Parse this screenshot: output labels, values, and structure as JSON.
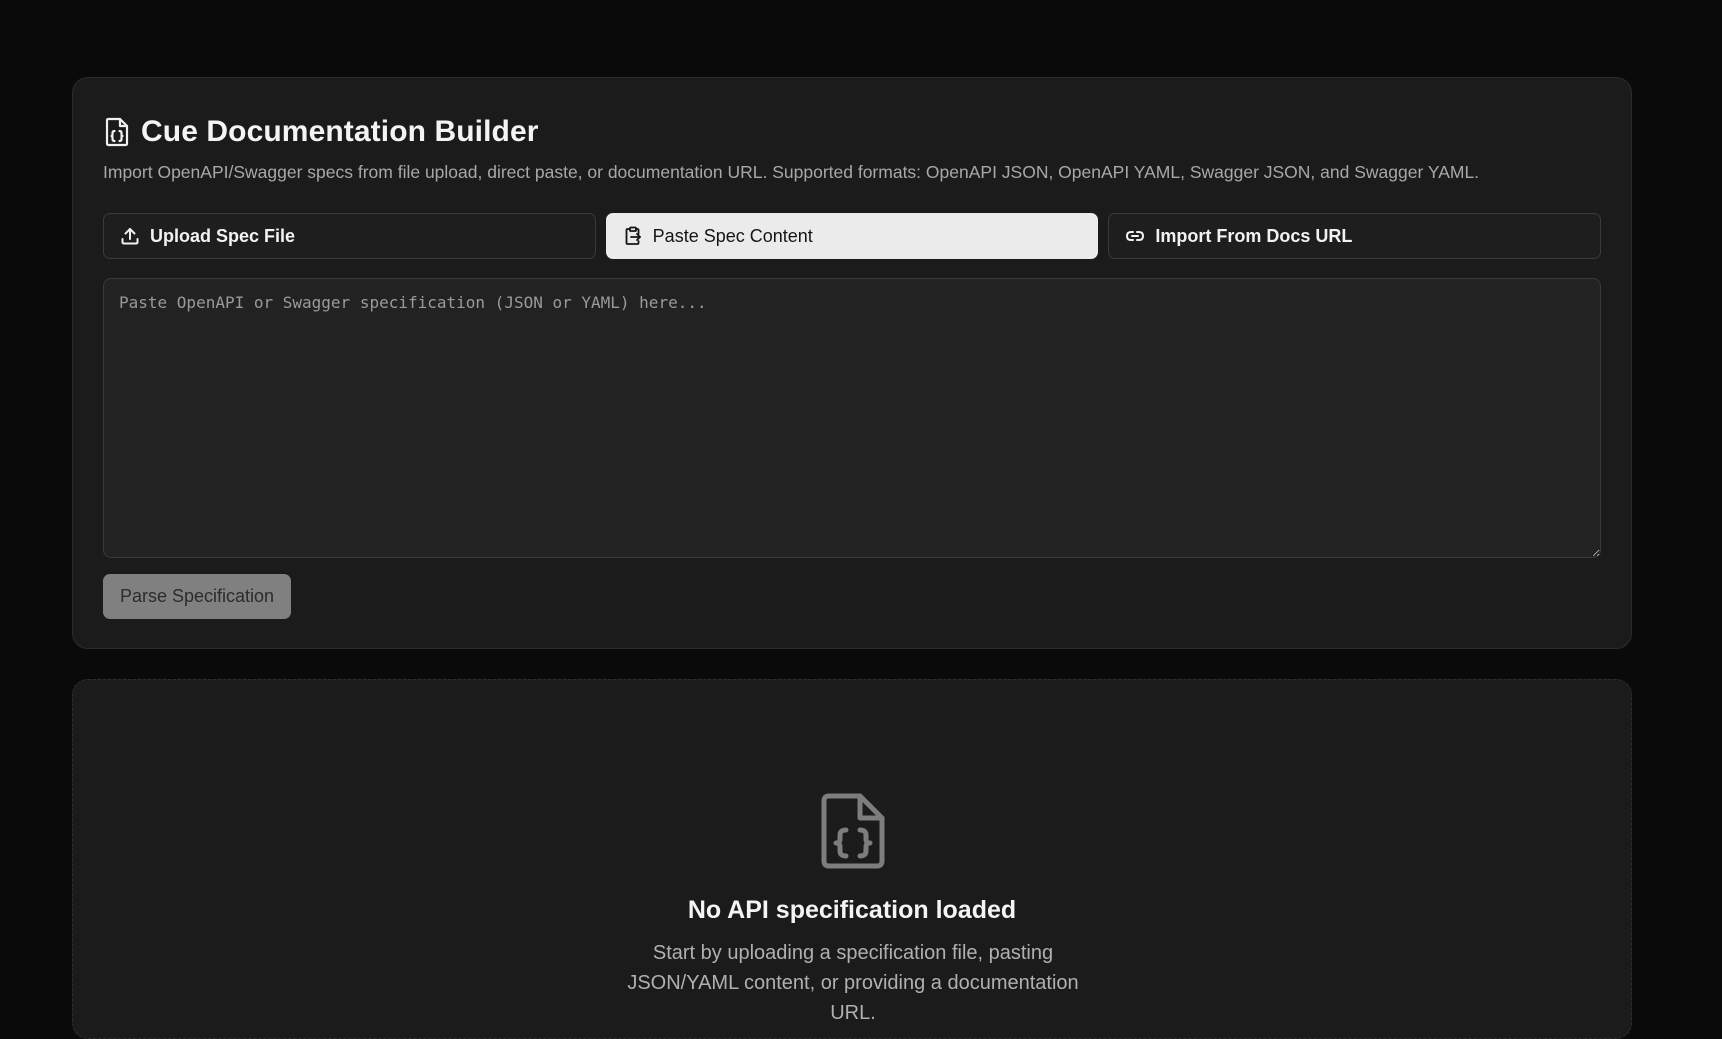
{
  "header": {
    "title": "Cue Documentation Builder",
    "icon": "file-code-icon",
    "description": "Import OpenAPI/Swagger specs from file upload, direct paste, or documentation URL. Supported formats: OpenAPI JSON, OpenAPI YAML, Swagger JSON, and Swagger YAML."
  },
  "tabs": [
    {
      "label": "Upload Spec File",
      "icon": "upload-icon",
      "active": false
    },
    {
      "label": "Paste Spec Content",
      "icon": "clipboard-icon",
      "active": true
    },
    {
      "label": "Import From Docs URL",
      "icon": "link-icon",
      "active": false
    }
  ],
  "spec_input": {
    "value": "",
    "placeholder": "Paste OpenAPI or Swagger specification (JSON or YAML) here..."
  },
  "parse_button": {
    "label": "Parse Specification",
    "disabled": true
  },
  "empty_state": {
    "icon": "file-code-icon",
    "title": "No API specification loaded",
    "description": "Start by uploading a specification file, pasting JSON/YAML content, or providing a documentation URL."
  },
  "colors": {
    "background": "#0a0a0a",
    "card": "#1b1b1b",
    "active_tab": "#ebebeb",
    "disabled_button": "#808080"
  }
}
